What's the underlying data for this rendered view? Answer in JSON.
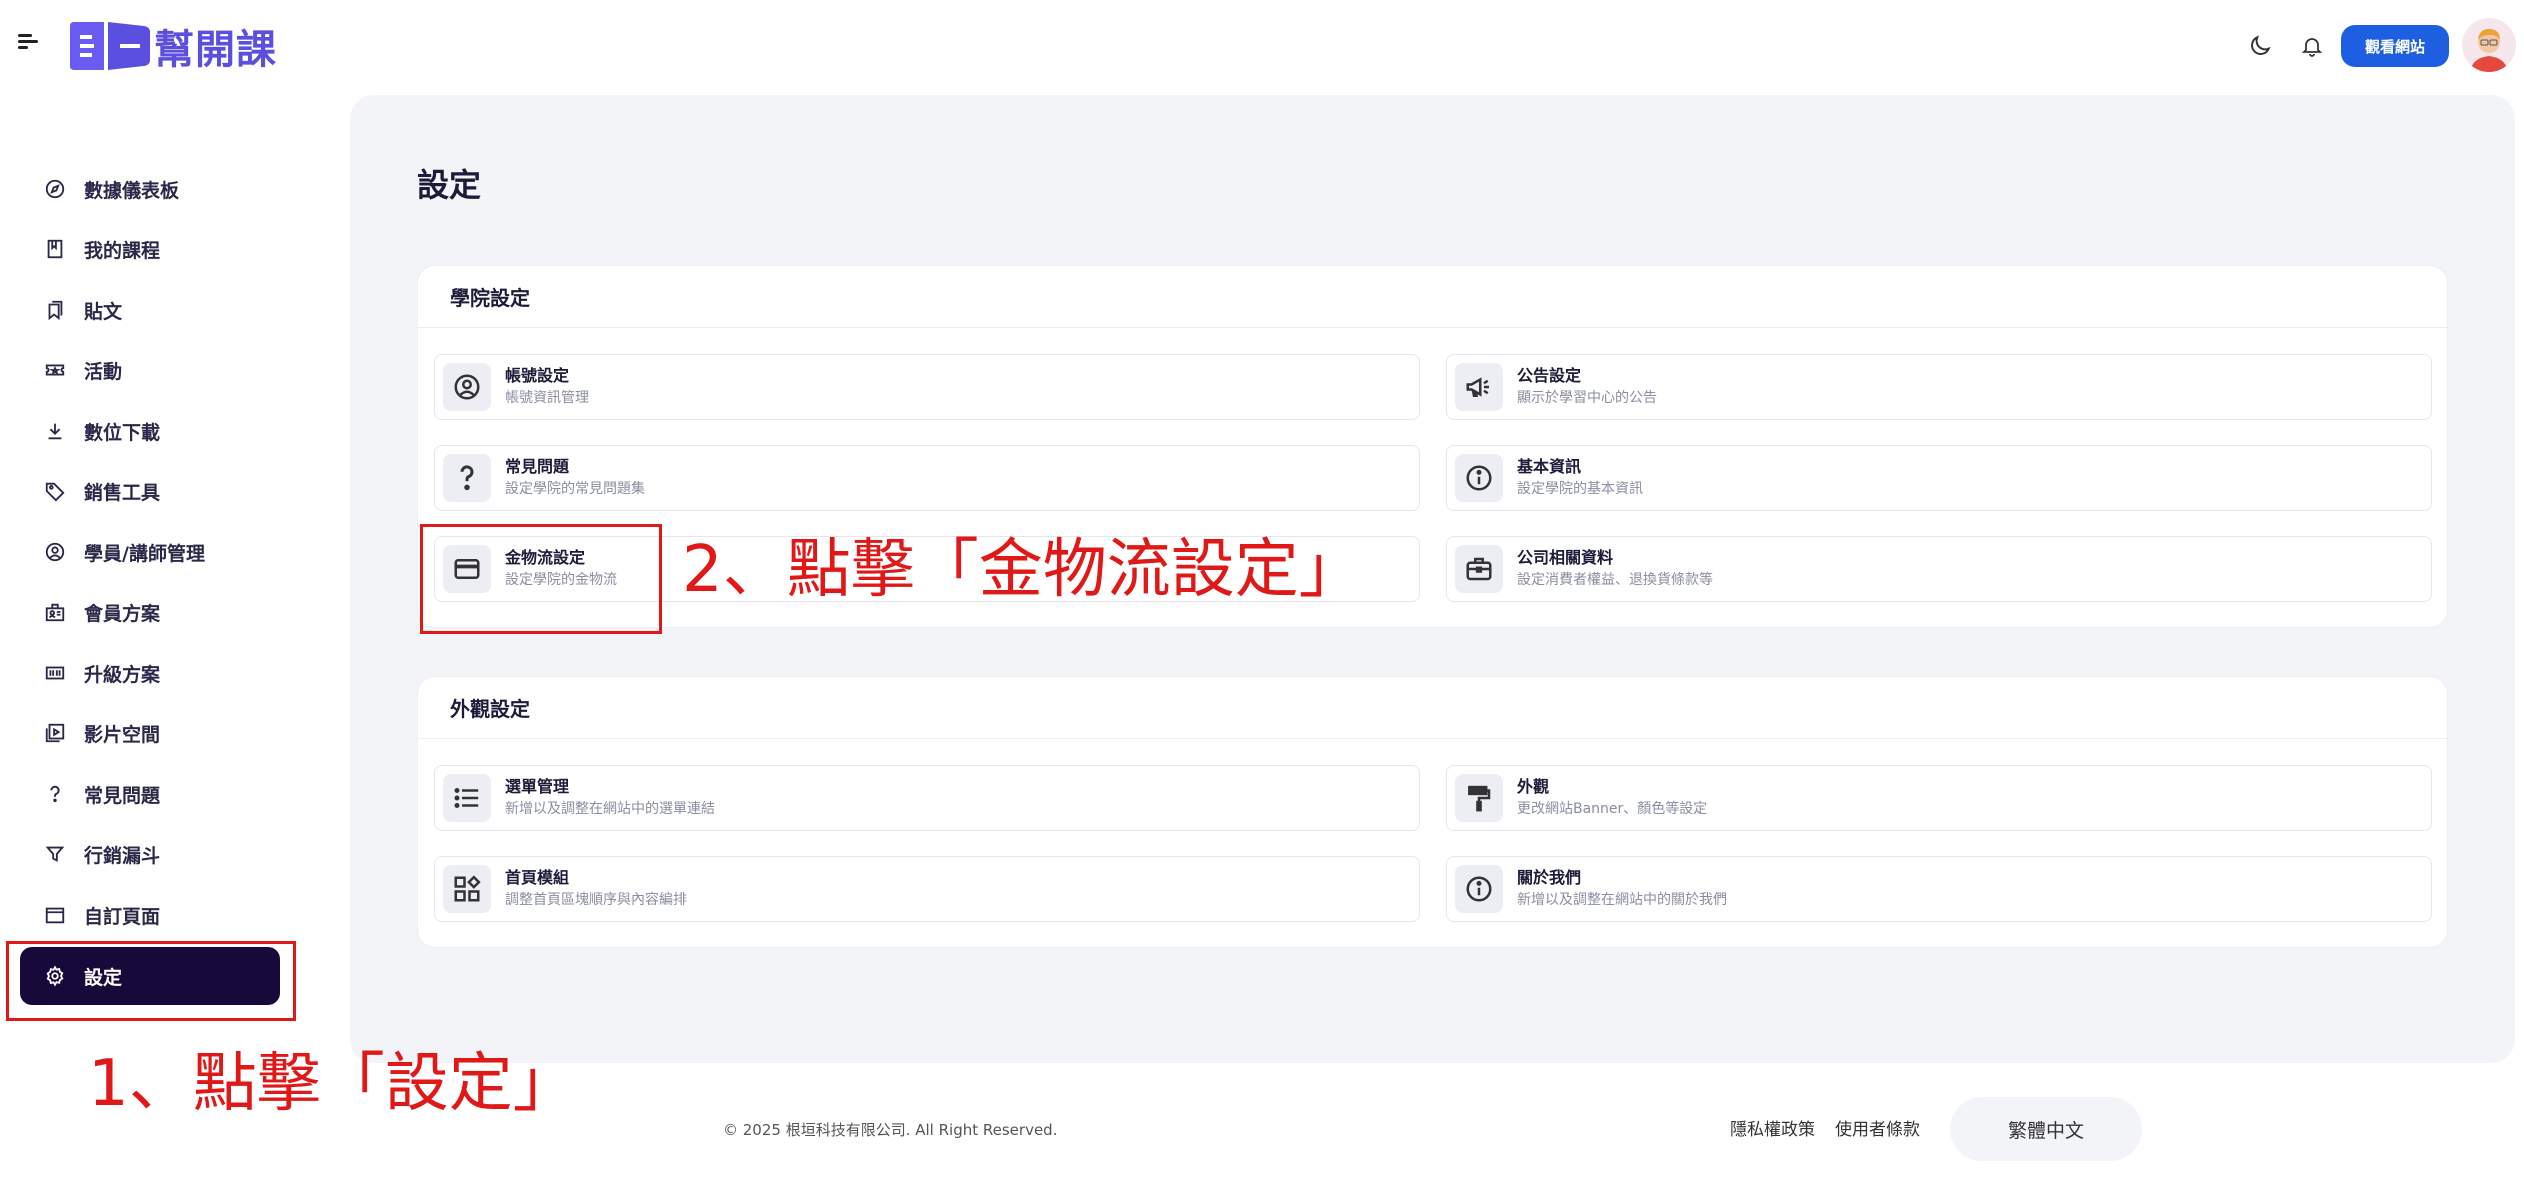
{
  "header": {
    "logo_text": "幫開課",
    "view_site_label": "觀看網站",
    "brand_color": "#5b4fe0",
    "button_color": "#1d5fe0"
  },
  "sidebar": {
    "items": [
      {
        "label": "數據儀表板",
        "icon": "compass-icon"
      },
      {
        "label": "我的課程",
        "icon": "book-icon"
      },
      {
        "label": "貼文",
        "icon": "bookmark-icon"
      },
      {
        "label": "活動",
        "icon": "ticket-icon"
      },
      {
        "label": "數位下載",
        "icon": "download-icon"
      },
      {
        "label": "銷售工具",
        "icon": "tag-icon"
      },
      {
        "label": "學員/講師管理",
        "icon": "user-circle-icon"
      },
      {
        "label": "會員方案",
        "icon": "badge-icon"
      },
      {
        "label": "升級方案",
        "icon": "upgrade-icon"
      },
      {
        "label": "影片空間",
        "icon": "video-icon"
      },
      {
        "label": "常見問題",
        "icon": "question-icon"
      },
      {
        "label": "行銷漏斗",
        "icon": "funnel-icon"
      },
      {
        "label": "自訂頁面",
        "icon": "window-icon"
      },
      {
        "label": "設定",
        "icon": "gear-icon",
        "active": true
      }
    ],
    "active_color": "#170a3a"
  },
  "main": {
    "title": "設定",
    "sections": [
      {
        "title": "學院設定",
        "tiles": [
          {
            "title": "帳號設定",
            "desc": "帳號資訊管理",
            "icon": "user-circle-icon"
          },
          {
            "title": "公告設定",
            "desc": "顯示於學習中心的公告",
            "icon": "megaphone-icon"
          },
          {
            "title": "常見問題",
            "desc": "設定學院的常見問題集",
            "icon": "question-icon"
          },
          {
            "title": "基本資訊",
            "desc": "設定學院的基本資訊",
            "icon": "info-icon"
          },
          {
            "title": "金物流設定",
            "desc": "設定學院的金物流",
            "icon": "credit-card-icon"
          },
          {
            "title": "公司相關資料",
            "desc": "設定消費者權益、退換貨條款等",
            "icon": "briefcase-icon"
          }
        ]
      },
      {
        "title": "外觀設定",
        "tiles": [
          {
            "title": "選單管理",
            "desc": "新增以及調整在網站中的選單連結",
            "icon": "list-icon"
          },
          {
            "title": "外觀",
            "desc": "更改網站Banner、顏色等設定",
            "icon": "paint-roller-icon"
          },
          {
            "title": "首頁模組",
            "desc": "調整首頁區塊順序與內容編排",
            "icon": "modules-icon"
          },
          {
            "title": "關於我們",
            "desc": "新增以及調整在網站中的關於我們",
            "icon": "info-icon"
          }
        ]
      }
    ]
  },
  "annotations": {
    "step1": "1、點擊「設定」",
    "step2": "2、點擊「金物流設定」",
    "color": "#e01818"
  },
  "footer": {
    "copyright": "© 2025 根垣科技有限公司. All Right Reserved.",
    "privacy": "隱私權政策",
    "terms": "使用者條款",
    "language": "繁體中文"
  }
}
